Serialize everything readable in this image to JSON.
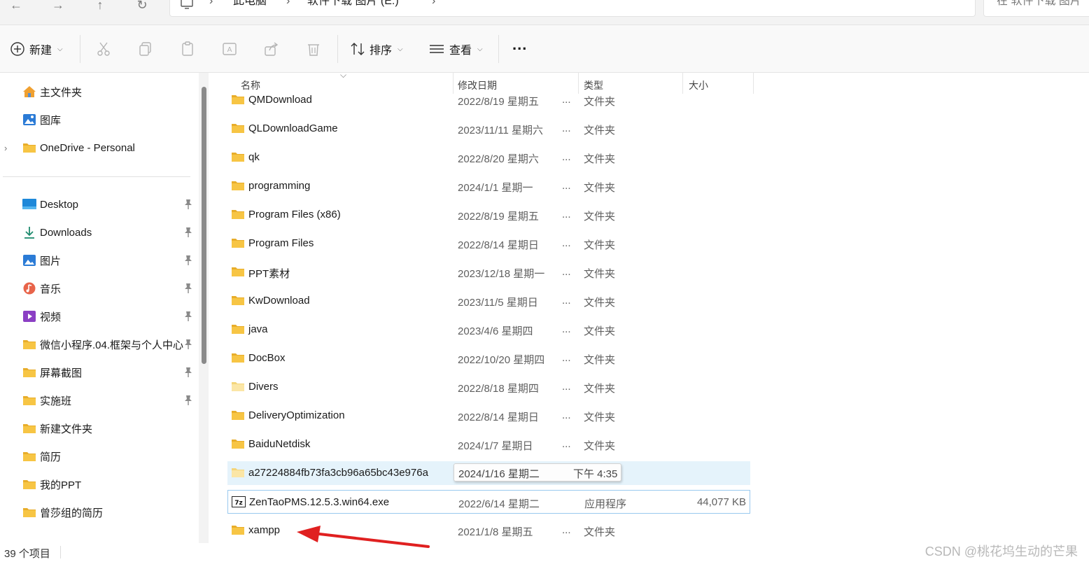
{
  "address": {
    "segments": [
      "此电脑",
      "软件下载  图片 (E:)"
    ],
    "search_placeholder": "在 软件下载  图片"
  },
  "toolbar": {
    "new_label": "新建",
    "sort_label": "排序",
    "view_label": "查看",
    "more_label": "..."
  },
  "sidebar": {
    "top": [
      {
        "label": "主文件夹",
        "icon": "home-icon"
      },
      {
        "label": "图库",
        "icon": "gallery-icon"
      },
      {
        "label": "OneDrive - Personal",
        "icon": "folder-icon"
      }
    ],
    "quick": [
      {
        "label": "Desktop",
        "icon": "desktop-icon",
        "pinned": true
      },
      {
        "label": "Downloads",
        "icon": "download-icon",
        "pinned": true
      },
      {
        "label": "图片",
        "icon": "pictures-icon",
        "pinned": true
      },
      {
        "label": "音乐",
        "icon": "music-icon",
        "pinned": true
      },
      {
        "label": "视频",
        "icon": "video-icon",
        "pinned": true
      },
      {
        "label": "微信小程序.04.框架与个人中心",
        "icon": "folder-icon",
        "pinned": true
      },
      {
        "label": "屏幕截图",
        "icon": "folder-icon",
        "pinned": true
      },
      {
        "label": "实施班",
        "icon": "folder-icon",
        "pinned": true
      },
      {
        "label": "新建文件夹",
        "icon": "folder-icon",
        "pinned": false
      },
      {
        "label": "简历",
        "icon": "folder-icon",
        "pinned": false
      },
      {
        "label": "我的PPT",
        "icon": "folder-icon",
        "pinned": false
      },
      {
        "label": "曾莎组的简历",
        "icon": "folder-icon",
        "pinned": false
      }
    ]
  },
  "columns": {
    "name": "名称",
    "modified": "修改日期",
    "type": "类型",
    "size": "大小"
  },
  "files": [
    {
      "name": "QMDownload",
      "date": "2022/8/19 星期五",
      "more": "...",
      "type": "文件夹",
      "size": "",
      "icon": "folder-icon"
    },
    {
      "name": "QLDownloadGame",
      "date": "2023/11/11 星期六",
      "more": "...",
      "type": "文件夹",
      "size": "",
      "icon": "folder-icon"
    },
    {
      "name": "qk",
      "date": "2022/8/20 星期六",
      "more": "...",
      "type": "文件夹",
      "size": "",
      "icon": "folder-icon"
    },
    {
      "name": "programming",
      "date": "2024/1/1 星期一",
      "more": "...",
      "type": "文件夹",
      "size": "",
      "icon": "folder-icon"
    },
    {
      "name": "Program Files (x86)",
      "date": "2022/8/19 星期五",
      "more": "...",
      "type": "文件夹",
      "size": "",
      "icon": "folder-icon"
    },
    {
      "name": "Program Files",
      "date": "2022/8/14 星期日",
      "more": "...",
      "type": "文件夹",
      "size": "",
      "icon": "folder-icon"
    },
    {
      "name": "PPT素材",
      "date": "2023/12/18 星期一",
      "more": "...",
      "type": "文件夹",
      "size": "",
      "icon": "folder-icon"
    },
    {
      "name": "KwDownload",
      "date": "2023/11/5 星期日",
      "more": "...",
      "type": "文件夹",
      "size": "",
      "icon": "folder-icon"
    },
    {
      "name": "java",
      "date": "2023/4/6 星期四",
      "more": "...",
      "type": "文件夹",
      "size": "",
      "icon": "folder-icon"
    },
    {
      "name": "DocBox",
      "date": "2022/10/20 星期四",
      "more": "...",
      "type": "文件夹",
      "size": "",
      "icon": "folder-icon"
    },
    {
      "name": "Divers",
      "date": "2022/8/18 星期四",
      "more": "...",
      "type": "文件夹",
      "size": "",
      "icon": "folder-light-icon"
    },
    {
      "name": "DeliveryOptimization",
      "date": "2022/8/14 星期日",
      "more": "...",
      "type": "文件夹",
      "size": "",
      "icon": "folder-icon"
    },
    {
      "name": "BaiduNetdisk",
      "date": "2024/1/7 星期日",
      "more": "...",
      "type": "文件夹",
      "size": "",
      "icon": "folder-icon"
    },
    {
      "name": "a27224884fb73fa3cb96a65bc43e976a",
      "date": "",
      "more": "",
      "type": "",
      "size": "",
      "icon": "folder-light-icon",
      "hover": true,
      "tooltip": {
        "date": "2024/1/16 星期二",
        "time": "下午 4:35"
      }
    },
    {
      "name": "ZenTaoPMS.12.5.3.win64.exe",
      "date": "2022/6/14 星期二",
      "more": "",
      "type": "应用程序",
      "size": "44,077 KB",
      "icon": "7z-icon",
      "selected": true
    },
    {
      "name": "xampp",
      "date": "2021/1/8 星期五",
      "more": "...",
      "type": "文件夹",
      "size": "",
      "icon": "folder-icon"
    }
  ],
  "status": {
    "count": "39 个项目"
  },
  "watermark": "CSDN @桃花坞生动的芒果",
  "colors": {
    "folder": "#f7c544",
    "hover_bg": "#e5f3fb",
    "selected_border": "#99c9ef",
    "arrow": "#e02020"
  }
}
